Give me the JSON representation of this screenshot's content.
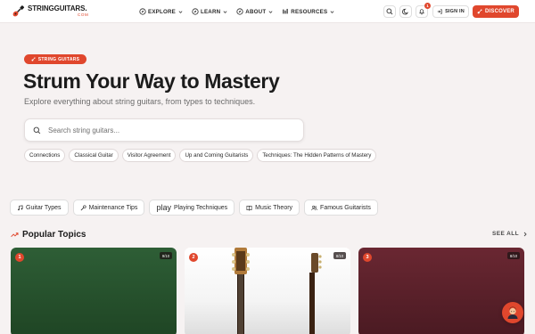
{
  "header": {
    "logo_main": "STRINGGUITARS.",
    "logo_sub": "COM",
    "nav": [
      {
        "label": "EXPLORE",
        "icon": "compass-icon"
      },
      {
        "label": "LEARN",
        "icon": "compass-icon"
      },
      {
        "label": "ABOUT",
        "icon": "compass-icon"
      },
      {
        "label": "RESOURCES",
        "icon": "bars-icon"
      }
    ],
    "notification_count": "1",
    "signin_label": "SIGN IN",
    "discover_label": "DISCOVER"
  },
  "hero": {
    "badge": "STRING GUITARS",
    "title": "Strum Your Way to Mastery",
    "subtitle": "Explore everything about string guitars, from types to techniques.",
    "search_placeholder": "Search string guitars..."
  },
  "chips": [
    "Connections",
    "Classical Guitar",
    "Visitor Agreement",
    "Up and Coming Guitarists",
    "Techniques: The Hidden Patterns of Mastery"
  ],
  "categories": [
    {
      "label": "Guitar Types",
      "icon": "music-note-icon"
    },
    {
      "label": "Maintenance Tips",
      "icon": "wrench-icon"
    },
    {
      "prefix": "play",
      "label": "Playing Techniques"
    },
    {
      "label": "Music Theory",
      "icon": "book-icon"
    },
    {
      "label": "Famous Guitarists",
      "icon": "users-icon"
    }
  ],
  "popular": {
    "title": "Popular Topics",
    "see_all": "SEE ALL",
    "cards": [
      {
        "rank": "1",
        "score": "9/10"
      },
      {
        "rank": "2",
        "score": "8/10"
      },
      {
        "rank": "3",
        "score": "8/10"
      }
    ]
  },
  "colors": {
    "accent": "#e0472d",
    "background": "#f6f2f2"
  }
}
